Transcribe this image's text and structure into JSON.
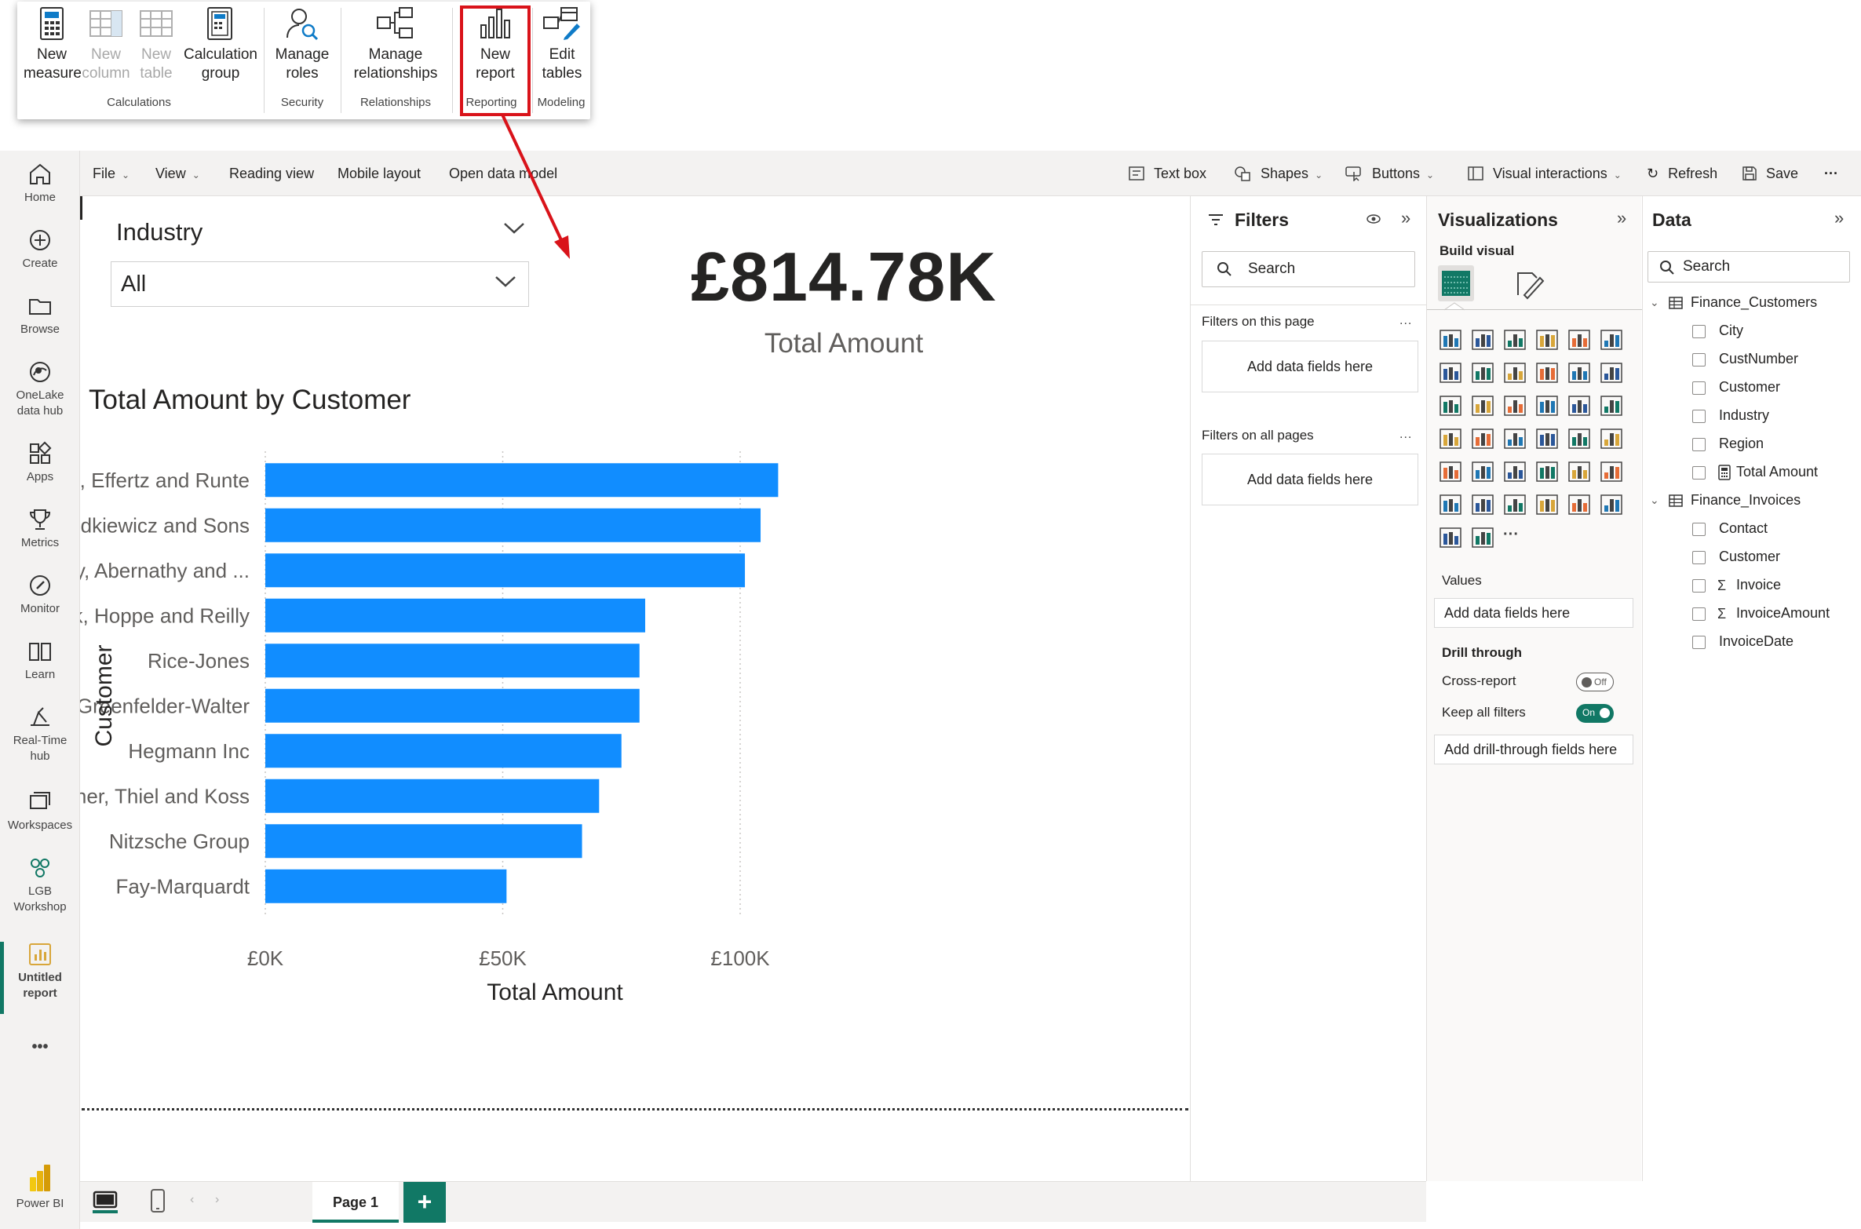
{
  "ribbon": {
    "groups": [
      {
        "label": "Calculations",
        "buttons": [
          {
            "label1": "New",
            "label2": "measure",
            "enabled": true
          },
          {
            "label1": "New",
            "label2": "column",
            "enabled": false
          },
          {
            "label1": "New",
            "label2": "table",
            "enabled": false
          },
          {
            "label1": "Calculation",
            "label2": "group",
            "enabled": true
          }
        ]
      },
      {
        "label": "Security",
        "buttons": [
          {
            "label1": "Manage",
            "label2": "roles",
            "enabled": true
          }
        ]
      },
      {
        "label": "Relationships",
        "buttons": [
          {
            "label1": "Manage",
            "label2": "relationships",
            "enabled": true
          }
        ]
      },
      {
        "label": "Reporting",
        "buttons": [
          {
            "label1": "New",
            "label2": "report",
            "enabled": true
          }
        ]
      },
      {
        "label": "Modeling",
        "buttons": [
          {
            "label1": "Edit",
            "label2": "tables",
            "enabled": true
          }
        ]
      }
    ],
    "highlight_color": "#d9131a"
  },
  "rail": {
    "items": [
      {
        "label": "Home"
      },
      {
        "label": "Create"
      },
      {
        "label": "Browse"
      },
      {
        "label": "OneLake",
        "label2": "data hub"
      },
      {
        "label": "Apps"
      },
      {
        "label": "Metrics"
      },
      {
        "label": "Monitor"
      },
      {
        "label": "Learn"
      },
      {
        "label": "Real-Time",
        "label2": "hub"
      },
      {
        "label": "Workspaces"
      },
      {
        "label": "LGB",
        "label2": "Workshop"
      },
      {
        "label": "Untitled",
        "label2": "report"
      }
    ],
    "more": "•••",
    "brand": "Power BI"
  },
  "topbar": {
    "file": "File",
    "view": "View",
    "reading_view": "Reading view",
    "mobile_layout": "Mobile layout",
    "open_data_model": "Open data model",
    "text_box": "Text box",
    "shapes": "Shapes",
    "buttons": "Buttons",
    "visual_interactions": "Visual interactions",
    "refresh": "Refresh",
    "save": "Save",
    "more": "···"
  },
  "slicer": {
    "title": "Industry",
    "value": "All"
  },
  "kpi": {
    "value": "£814.78K",
    "label": "Total Amount"
  },
  "chart_data": {
    "type": "bar",
    "orientation": "horizontal",
    "title": "Total Amount by Customer",
    "xlabel": "Total Amount",
    "ylabel": "Customer",
    "categories": [
      "Hills, Effertz and Runte",
      "Hodkiewicz and Sons",
      "Quigley, Abernathy and ...",
      "Zemlak, Hoppe and Reilly",
      "Rice-Jones",
      "Greenfelder-Walter",
      "Hegmann Inc",
      "Fisher, Thiel and Koss",
      "Nitzsche Group",
      "Fay-Marquardt"
    ],
    "values": [
      108000,
      104300,
      101000,
      80000,
      78800,
      78800,
      75000,
      70300,
      66700,
      50800
    ],
    "xlim": [
      0,
      120000
    ],
    "x_ticks": [
      0,
      50000,
      100000
    ],
    "x_tick_labels": [
      "£0K",
      "£50K",
      "£100K"
    ],
    "bar_color": "#118dff",
    "grid": true
  },
  "pages": {
    "page1": "Page 1",
    "add": "+"
  },
  "filters": {
    "title": "Filters",
    "search_placeholder": "Search",
    "on_this_page": "Filters on this page",
    "on_all_pages": "Filters on all pages",
    "add_fields": "Add data fields here",
    "more": "..."
  },
  "visualizations": {
    "title": "Visualizations",
    "build_visual": "Build visual",
    "values_label": "Values",
    "values_well": "Add data fields here",
    "drill_through": "Drill through",
    "cross_report": "Cross-report",
    "cross_report_state": "Off",
    "keep_all_filters": "Keep all filters",
    "keep_all_filters_state": "On",
    "drill_well": "Add drill-through fields here",
    "more_visuals": "···"
  },
  "data_pane": {
    "title": "Data",
    "search_placeholder": "Search",
    "tables": [
      {
        "name": "Finance_Customers",
        "fields": [
          {
            "name": "City",
            "kind": "text"
          },
          {
            "name": "CustNumber",
            "kind": "text"
          },
          {
            "name": "Customer",
            "kind": "text"
          },
          {
            "name": "Industry",
            "kind": "text"
          },
          {
            "name": "Region",
            "kind": "text"
          },
          {
            "name": "Total Amount",
            "kind": "measure"
          }
        ]
      },
      {
        "name": "Finance_Invoices",
        "fields": [
          {
            "name": "Contact",
            "kind": "text"
          },
          {
            "name": "Customer",
            "kind": "text"
          },
          {
            "name": "Invoice",
            "kind": "sum"
          },
          {
            "name": "InvoiceAmount",
            "kind": "sum"
          },
          {
            "name": "InvoiceDate",
            "kind": "text"
          }
        ]
      }
    ]
  },
  "accent_color": "#117865"
}
